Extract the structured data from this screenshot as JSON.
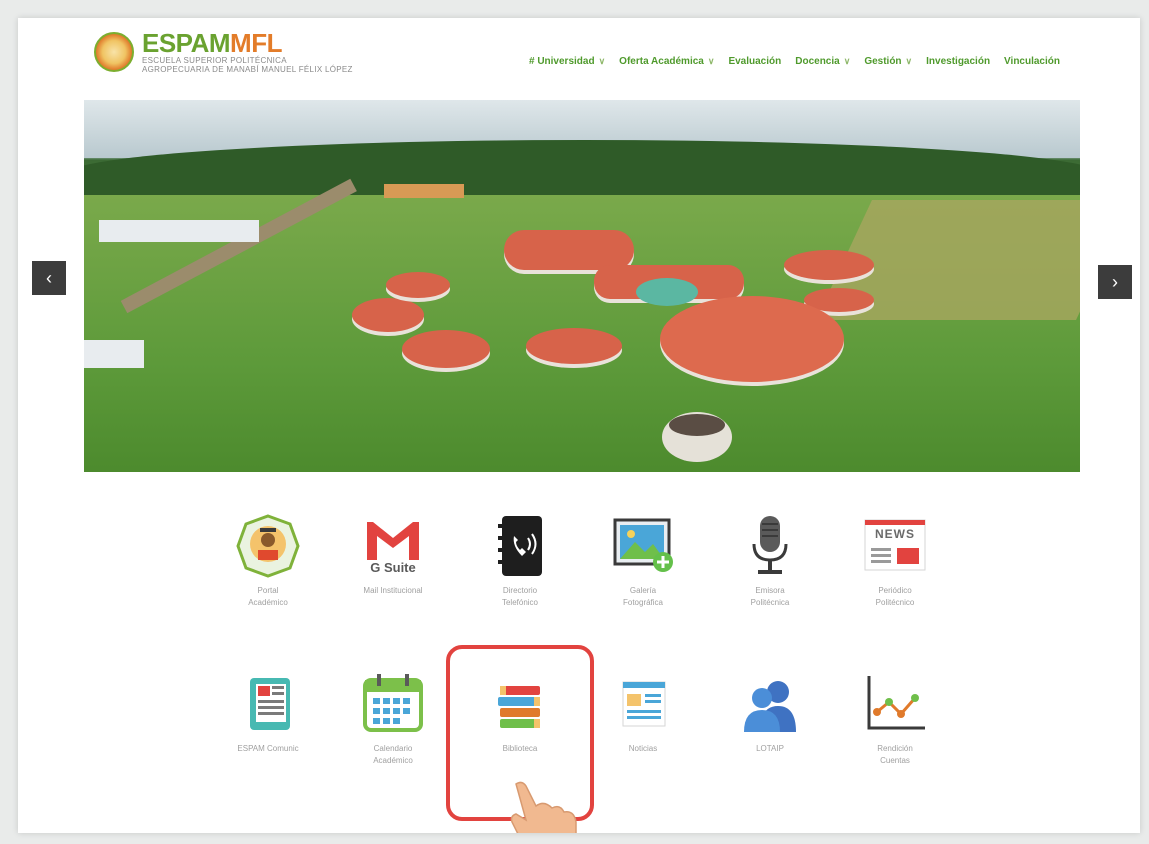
{
  "header": {
    "logo_name_a": "ESPAM",
    "logo_name_b": "MFL",
    "logo_sub_1": "ESCUELA SUPERIOR POLITÉCNICA",
    "logo_sub_2": "AGROPECUARIA DE MANABÍ MANUEL FÉLIX LÓPEZ"
  },
  "nav": {
    "items": [
      {
        "label": "# Universidad",
        "has_dropdown": true
      },
      {
        "label": "Oferta Académica",
        "has_dropdown": true
      },
      {
        "label": "Evaluación",
        "has_dropdown": false
      },
      {
        "label": "Docencia",
        "has_dropdown": true
      },
      {
        "label": "Gestión",
        "has_dropdown": true
      },
      {
        "label": "Investigación",
        "has_dropdown": false
      },
      {
        "label": "Vinculación",
        "has_dropdown": false
      }
    ],
    "dropdown_glyph": "∨"
  },
  "slider": {
    "prev_glyph": "‹",
    "next_glyph": "›"
  },
  "tiles": [
    {
      "icon": "academic-portal-icon",
      "line1": "Portal",
      "line2": "Académico"
    },
    {
      "icon": "gmail-gsuite-icon",
      "line1": "Mail Institucional",
      "line2": "",
      "brand": "G Suite"
    },
    {
      "icon": "phone-directory-icon",
      "line1": "Directorio",
      "line2": "Telefónico"
    },
    {
      "icon": "photo-gallery-icon",
      "line1": "Galería",
      "line2": "Fotográfica"
    },
    {
      "icon": "microphone-icon",
      "line1": "Emisora",
      "line2": "Politécnica"
    },
    {
      "icon": "news-icon",
      "line1": "Periódico",
      "line2": "Politécnico",
      "brand": "NEWS"
    },
    {
      "icon": "newspaper-icon",
      "line1": "ESPAM Comunic",
      "line2": ""
    },
    {
      "icon": "calendar-icon",
      "line1": "Calendario",
      "line2": "Académico"
    },
    {
      "icon": "books-icon",
      "line1": "Biblioteca",
      "line2": ""
    },
    {
      "icon": "news-bulletin-icon",
      "line1": "Noticias",
      "line2": ""
    },
    {
      "icon": "users-icon",
      "line1": "LOTAIP",
      "line2": ""
    },
    {
      "icon": "line-chart-icon",
      "line1": "Rendición",
      "line2": "Cuentas"
    }
  ],
  "colors": {
    "brand_green": "#4f9a2c",
    "brand_orange": "#e37c29",
    "highlight_red": "#e2433f"
  }
}
